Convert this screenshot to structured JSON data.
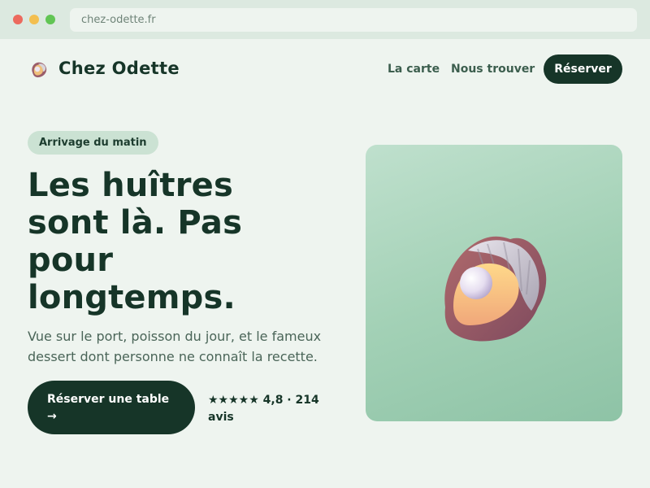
{
  "browser": {
    "url": "chez-odette.fr"
  },
  "nav": {
    "brand": "Chez Odette",
    "logo_icon": "oyster-icon",
    "links": [
      "La carte",
      "Nous trouver"
    ],
    "cta": "Réserver"
  },
  "hero": {
    "badge": "Arrivage du matin",
    "headline": "Les huîtres sont là. Pas pour longtemps.",
    "subtitle": "Vue sur le port, poisson du jour, et le fameux dessert dont personne ne connaît la recette.",
    "cta": "Réserver une table →",
    "rating": "★★★★★ 4,8 · 214 avis"
  },
  "image": {
    "icon": "oyster-pearl-icon"
  },
  "colors": {
    "primary": "#163528",
    "background": "#eef4ef",
    "accent": "#a3d1b6"
  }
}
